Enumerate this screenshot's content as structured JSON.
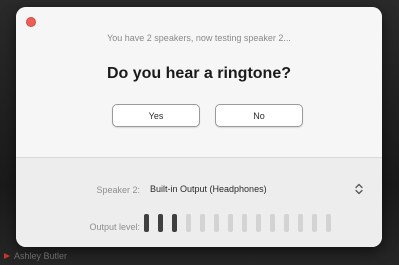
{
  "dialog": {
    "status_text": "You have 2 speakers, now testing speaker 2...",
    "question": "Do you hear a ringtone?",
    "yes_label": "Yes",
    "no_label": "No",
    "speaker_label": "Speaker 2:",
    "speaker_value": "Built-in Output (Headphones)",
    "output_label": "Output level:",
    "output_level": {
      "active_bars": 3,
      "total_bars": 14
    }
  },
  "background": {
    "participant_name": "Ashley Butler"
  },
  "colors": {
    "close_button": "#ec5f58",
    "meter_active": "#404040",
    "meter_inactive": "#d3d3d3",
    "name_mark": "#c0392b"
  },
  "icons": {
    "close": "close-dot-icon",
    "select": "chevron-updown-icon",
    "name_mark": "mic-muted-icon"
  }
}
